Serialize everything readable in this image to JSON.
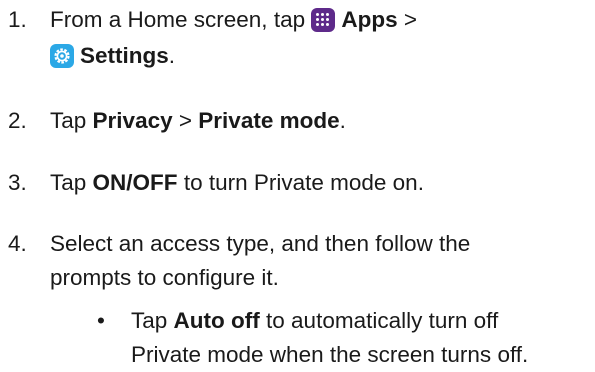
{
  "steps": [
    {
      "number": "1.",
      "line1_prefix": "From a Home screen, tap",
      "apps_label": "Apps",
      "separator1": ">",
      "settings_label": "Settings",
      "period": "."
    },
    {
      "number": "2.",
      "prefix": "Tap",
      "bold1": "Privacy",
      "separator": ">",
      "bold2": "Private mode",
      "period": "."
    },
    {
      "number": "3.",
      "prefix": "Tap",
      "bold": "ON/OFF",
      "suffix": "to turn Private mode on."
    },
    {
      "number": "4.",
      "line1": "Select an access type, and then follow the",
      "line2": "prompts to configure it."
    }
  ],
  "bullet": {
    "symbol": "•",
    "prefix": "Tap",
    "bold": "Auto off",
    "suffix": "to automatically turn off",
    "line2": "Private mode when the screen turns off."
  },
  "icons": {
    "apps": "apps-grid-icon",
    "settings": "settings-gear-icon"
  },
  "colors": {
    "apps_icon": "#5e2a8a",
    "settings_icon": "#2ba8e6"
  }
}
